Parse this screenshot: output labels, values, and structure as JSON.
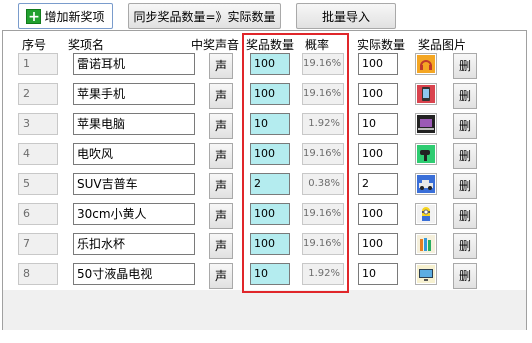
{
  "toolbar": {
    "add_label": "增加新奖项",
    "sync_label": "同步奖品数量=》实际数量",
    "import_label": "批量导入"
  },
  "headers": {
    "index": "序号",
    "name": "奖项名",
    "sound": "中奖声音",
    "quantity": "奖品数量",
    "probability": "概率",
    "actual": "实际数量",
    "image": "奖品图片"
  },
  "rows": [
    {
      "index": "1",
      "name": "雷诺耳机",
      "sound": "声",
      "quantity": "100",
      "probability": "19.16%",
      "actual": "100",
      "image": "headphones-icon",
      "delete": "删"
    },
    {
      "index": "2",
      "name": "苹果手机",
      "sound": "声",
      "quantity": "100",
      "probability": "19.16%",
      "actual": "100",
      "image": "phone-icon",
      "delete": "删"
    },
    {
      "index": "3",
      "name": "苹果电脑",
      "sound": "声",
      "quantity": "10",
      "probability": "1.92%",
      "actual": "10",
      "image": "laptop-icon",
      "delete": "删"
    },
    {
      "index": "4",
      "name": "电吹风",
      "sound": "声",
      "quantity": "100",
      "probability": "19.16%",
      "actual": "100",
      "image": "hair-dryer-icon",
      "delete": "删"
    },
    {
      "index": "5",
      "name": "SUV吉普车",
      "sound": "声",
      "quantity": "2",
      "probability": "0.38%",
      "actual": "2",
      "image": "car-icon",
      "delete": "删"
    },
    {
      "index": "6",
      "name": "30cm小黄人",
      "sound": "声",
      "quantity": "100",
      "probability": "19.16%",
      "actual": "100",
      "image": "minion-icon",
      "delete": "删"
    },
    {
      "index": "7",
      "name": "乐扣水杯",
      "sound": "声",
      "quantity": "100",
      "probability": "19.16%",
      "actual": "100",
      "image": "cup-icon",
      "delete": "删"
    },
    {
      "index": "8",
      "name": "50寸液晶电视",
      "sound": "声",
      "quantity": "10",
      "probability": "1.92%",
      "actual": "10",
      "image": "tv-icon",
      "delete": "删"
    }
  ],
  "colors": {
    "quantity_bg": "#b4ecef",
    "highlight_border": "#e0262a"
  }
}
